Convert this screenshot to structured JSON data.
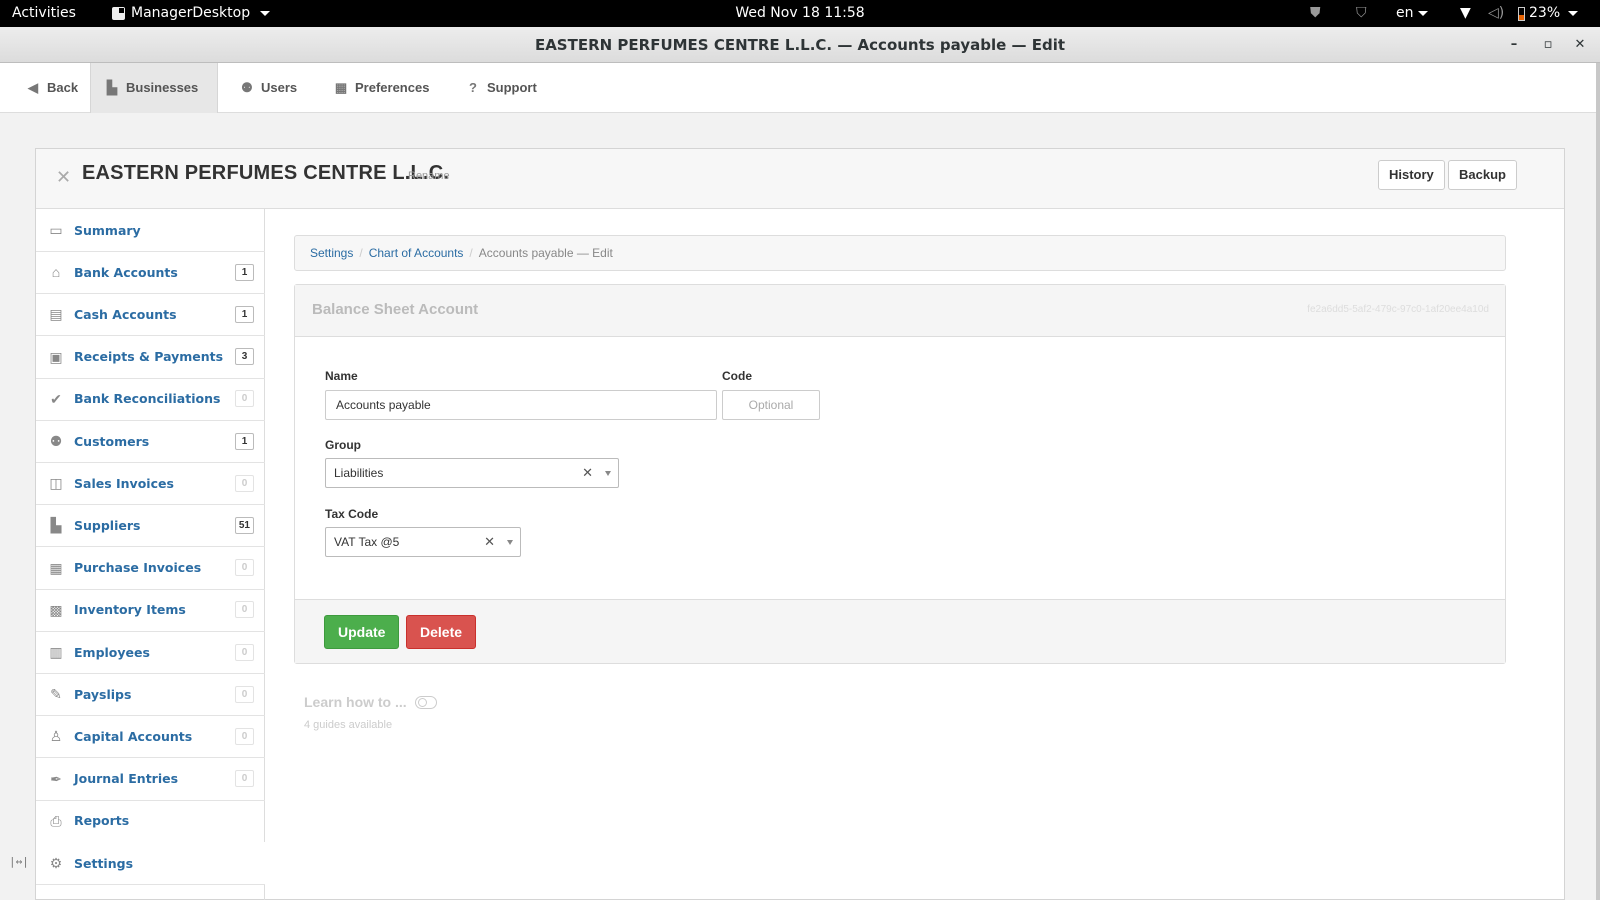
{
  "topbar": {
    "activities": "Activities",
    "app_name": "ManagerDesktop",
    "clock": "Wed Nov 18  11:58",
    "language": "en",
    "battery": "23%"
  },
  "window": {
    "title": "EASTERN PERFUMES CENTRE L.L.C. — Accounts payable — Edit"
  },
  "nav": {
    "back": "Back",
    "businesses": "Businesses",
    "users": "Users",
    "preferences": "Preferences",
    "support": "Support"
  },
  "business": {
    "name": "EASTERN PERFUMES CENTRE L.L.C.",
    "rename": "Rename",
    "history_button": "History",
    "backup_button": "Backup"
  },
  "sidebar": {
    "items": [
      {
        "label": "Summary",
        "icon": "presentation-icon",
        "count": null
      },
      {
        "label": "Bank Accounts",
        "icon": "bank-icon",
        "count": "1"
      },
      {
        "label": "Cash Accounts",
        "icon": "cash-register-icon",
        "count": "1"
      },
      {
        "label": "Receipts & Payments",
        "icon": "receipts-icon",
        "count": "3"
      },
      {
        "label": "Bank Reconciliations",
        "icon": "checkmark-icon",
        "count": "0"
      },
      {
        "label": "Customers",
        "icon": "customers-icon",
        "count": "1"
      },
      {
        "label": "Sales Invoices",
        "icon": "inbox-icon",
        "count": "0"
      },
      {
        "label": "Suppliers",
        "icon": "buildings-icon",
        "count": "51"
      },
      {
        "label": "Purchase Invoices",
        "icon": "calendar-icon",
        "count": "0"
      },
      {
        "label": "Inventory Items",
        "icon": "box-icon",
        "count": "0"
      },
      {
        "label": "Employees",
        "icon": "id-card-icon",
        "count": "0"
      },
      {
        "label": "Payslips",
        "icon": "payslip-icon",
        "count": "0"
      },
      {
        "label": "Capital Accounts",
        "icon": "person-icon",
        "count": "0"
      },
      {
        "label": "Journal Entries",
        "icon": "quill-icon",
        "count": "0"
      },
      {
        "label": "Reports",
        "icon": "printer-icon",
        "count": null
      },
      {
        "label": "Settings",
        "icon": "gears-icon",
        "count": null
      }
    ]
  },
  "breadcrumb": {
    "settings": "Settings",
    "chart_of_accounts": "Chart of Accounts",
    "current": "Accounts payable — Edit"
  },
  "form": {
    "title": "Balance Sheet Account",
    "guid": "fe2a6dd5-5af2-479c-97c0-1af20ee4a10d",
    "name_label": "Name",
    "name_value": "Accounts payable",
    "code_label": "Code",
    "code_placeholder": "Optional",
    "group_label": "Group",
    "group_value": "Liabilities",
    "tax_label": "Tax Code",
    "tax_value": "VAT Tax @5",
    "update_button": "Update",
    "delete_button": "Delete"
  },
  "learn": {
    "title": "Learn how to ...",
    "guides": "4 guides available"
  }
}
